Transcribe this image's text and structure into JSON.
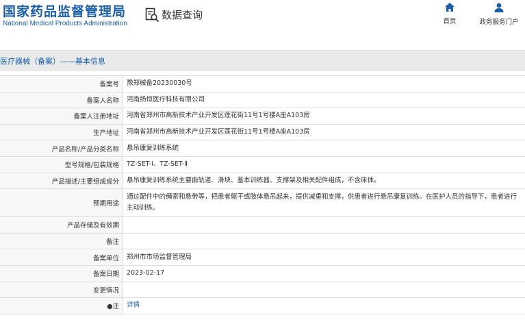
{
  "header": {
    "logo_cn": "国家药品监督管理局",
    "logo_en": "National Medical Products Administration",
    "query_label": "数据查询",
    "nav": [
      {
        "label": "首页",
        "icon": "home-icon"
      },
      {
        "label": "政务服务门户",
        "icon": "user-icon"
      }
    ]
  },
  "section": {
    "title": "医疗器械（备案）——基本信息"
  },
  "rows": [
    {
      "key": "备案号",
      "value": "豫郑械备20230030号"
    },
    {
      "key": "备案人名称",
      "value": "河南扬恒医疗科技有限公司"
    },
    {
      "key": "备案人注册地址",
      "value": "河南省郑州市高新技术产业开发区莲花街11号1号楼A座A103房"
    },
    {
      "key": "生产地址",
      "value": "河南省郑州市高新技术产业开发区莲花街11号1号楼A座A103房"
    },
    {
      "key": "产品名称/产品分类名称",
      "value": "悬吊康复训练系统"
    },
    {
      "key": "型号规格/包装规格",
      "value": "TZ-SET-Ⅰ、TZ-SET-Ⅱ"
    },
    {
      "key": "产品描述/主要组成成分",
      "value": "悬吊康复训练系统主要由轨道、滑块、基本训练器、支撑架及相关配件组成，不含床体。"
    },
    {
      "key": "预期用途",
      "value": "通过配件中的绳索和悬带等，把患者躯干或肢体悬吊起来，提供减重和支撑，供患者进行悬吊康复训练。在医护人员的指导下，患者进行主动训练。"
    },
    {
      "key": "产品存储及有效期",
      "value": ""
    },
    {
      "key": "备注",
      "value": ""
    },
    {
      "key": "备案单位",
      "value": "郑州市市场监督管理局"
    },
    {
      "key": "备案日期",
      "value": "2023-02-17"
    },
    {
      "key": "变更情况",
      "value": ""
    },
    {
      "key": "●注",
      "value": "详情"
    }
  ],
  "colors": {
    "brand": "#1a5ea8",
    "section_bg": "#eaeaea",
    "border": "#dcdcdc"
  }
}
